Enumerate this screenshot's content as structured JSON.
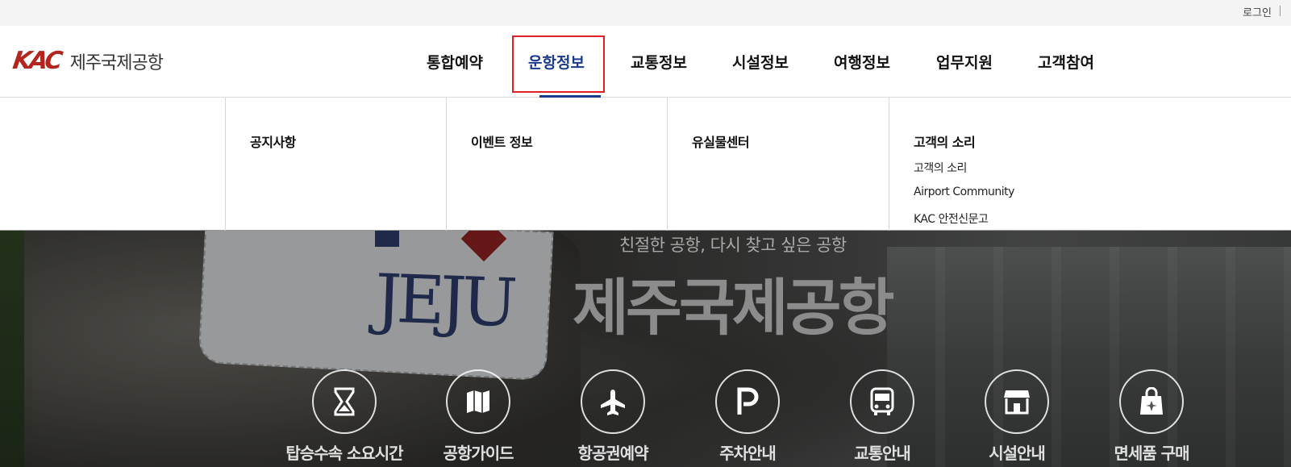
{
  "topbar": {
    "login": "로그인"
  },
  "header": {
    "logo_mark": "KAC",
    "logo_text": "제주국제공항"
  },
  "nav": {
    "items": [
      {
        "label": "통합예약"
      },
      {
        "label": "운항정보",
        "active": true
      },
      {
        "label": "교통정보"
      },
      {
        "label": "시설정보"
      },
      {
        "label": "여행정보"
      },
      {
        "label": "업무지원"
      },
      {
        "label": "고객참여"
      }
    ]
  },
  "dropdown": {
    "columns": [
      {
        "title": "공지사항",
        "links": []
      },
      {
        "title": "이벤트 정보",
        "links": []
      },
      {
        "title": "유실물센터",
        "links": []
      },
      {
        "title": "고객의 소리",
        "links": [
          "고객의 소리",
          "Airport Community",
          "KAC 안전신문고"
        ]
      }
    ]
  },
  "hero": {
    "sign_text": "JEJU",
    "subtitle": "친절한 공항, 다시 찾고 싶은 공항",
    "title": "제주국제공항"
  },
  "quick_links": [
    {
      "label": "탑승수속 소요시간",
      "icon": "hourglass-icon"
    },
    {
      "label": "공항가이드",
      "icon": "map-icon"
    },
    {
      "label": "항공권예약",
      "icon": "airplane-icon"
    },
    {
      "label": "주차안내",
      "icon": "parking-icon"
    },
    {
      "label": "교통안내",
      "icon": "bus-icon"
    },
    {
      "label": "시설안내",
      "icon": "store-icon"
    },
    {
      "label": "면세품 구매",
      "icon": "dutyfree-bag-icon"
    }
  ],
  "colors": {
    "brand_red": "#b3261e",
    "active_nav": "#1a3b8c",
    "highlight_box": "#e21f26"
  }
}
